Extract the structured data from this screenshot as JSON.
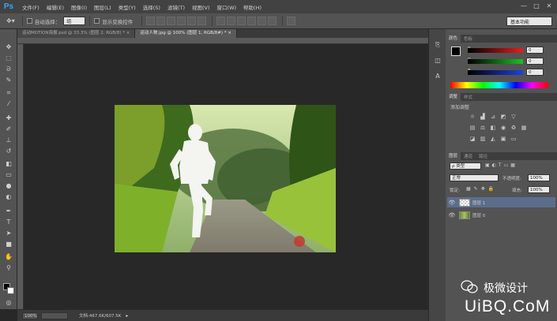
{
  "menubar": {
    "logo": "Ps",
    "items": [
      "文件(F)",
      "编辑(E)",
      "图像(I)",
      "图层(L)",
      "类型(Y)",
      "选择(S)",
      "滤镜(T)",
      "视图(V)",
      "窗口(W)",
      "帮助(H)"
    ],
    "minimize": "—",
    "maximize": "□",
    "close": "✕"
  },
  "options": {
    "auto_select_label": "自动选择：",
    "auto_select_value": "组",
    "show_transform_label": "显示变换控件",
    "workspace": "基本功能"
  },
  "tabs": [
    {
      "label": "运动MOTION海报.psd @ 33.3% (图层 2, RGB/8) *  ×",
      "active": false
    },
    {
      "label": "运动人物.jpg @ 100% (图层 1, RGB/8#) *  ×",
      "active": true
    }
  ],
  "status": {
    "zoom": "100%",
    "doc": "文档:467.6K/607.5K"
  },
  "color_panel": {
    "tabs": [
      "颜色",
      "色板"
    ],
    "channels": [
      {
        "label": "R",
        "value": "0",
        "color": "#e02020"
      },
      {
        "label": "G",
        "value": "0",
        "color": "#20c020"
      },
      {
        "label": "B",
        "value": "0",
        "color": "#2040e0"
      }
    ]
  },
  "adjust_panel": {
    "tabs": [
      "调整",
      "样式"
    ],
    "title": "添加调整"
  },
  "layers_panel": {
    "tabs": [
      "图层",
      "通道",
      "路径"
    ],
    "filter": "ρ 类型",
    "blend_mode": "正常",
    "opacity_label": "不透明度:",
    "opacity": "100%",
    "lock_label": "锁定:",
    "fill_label": "填充:",
    "fill": "100%",
    "layers": [
      {
        "name": "图层 1",
        "selected": true
      },
      {
        "name": "图层 0",
        "selected": false
      }
    ]
  },
  "watermark": {
    "brand": "极微设计",
    "site": "UiBQ.CoM"
  },
  "colors": {
    "accent": "#31a8ff",
    "selected_layer": "#5a6e8c"
  }
}
